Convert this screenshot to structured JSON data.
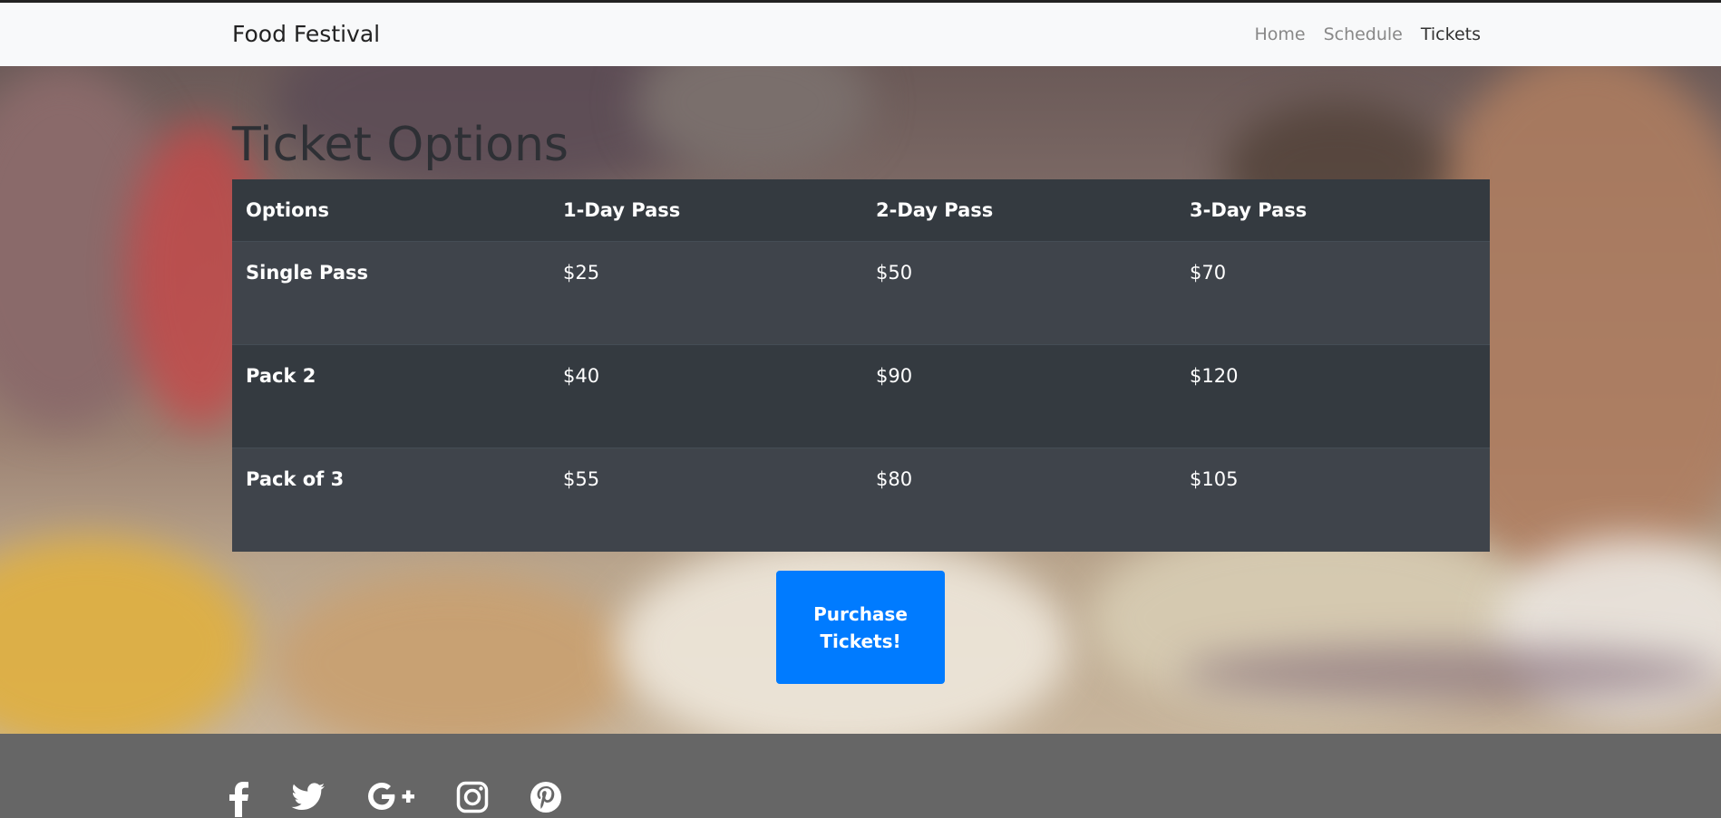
{
  "navbar": {
    "brand": "Food Festival",
    "links": [
      {
        "label": "Home"
      },
      {
        "label": "Schedule"
      },
      {
        "label": "Tickets"
      }
    ]
  },
  "tickets": {
    "title": "Ticket Options",
    "columns": [
      "Options",
      "1-Day Pass",
      "2-Day Pass",
      "3-Day Pass"
    ],
    "rows": [
      {
        "name": "Single Pass",
        "values": [
          "$25",
          "$50",
          "$70"
        ]
      },
      {
        "name": "Pack 2",
        "values": [
          "$40",
          "$90",
          "$120"
        ]
      },
      {
        "name": "Pack of 3",
        "values": [
          "$55",
          "$80",
          "$105"
        ]
      }
    ],
    "purchase_label": "Purchase Tickets!"
  },
  "footer": {
    "social_icons": [
      "facebook-icon",
      "twitter-icon",
      "google-plus-icon",
      "instagram-icon",
      "pinterest-icon"
    ]
  },
  "colors": {
    "navbar_bg": "#f8f9fa",
    "table_dark": "#343a40",
    "table_stripe": "#3f444b",
    "button_primary": "#007bff",
    "footer_bg": "#666666"
  }
}
